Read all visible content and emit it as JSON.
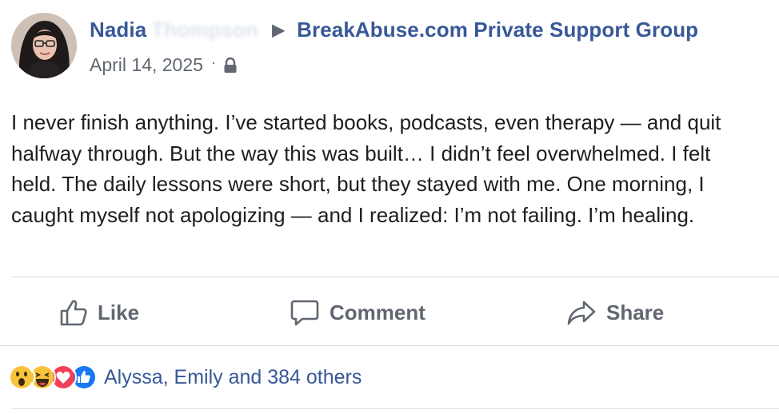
{
  "post": {
    "author_first": "Nadia",
    "author_last": "Thompson",
    "separator_icon": "triangle-right-icon",
    "group_name": "BreakAbuse.com Private Support Group",
    "date": "April 14, 2025",
    "meta_separator": "·",
    "privacy_icon": "lock-icon",
    "text": "I never finish anything. I’ve started books, podcasts, even therapy — and quit halfway through. But the way this was built… I didn’t feel overwhelmed. I felt held. The daily lessons were short, but they stayed with me. One morning, I caught myself not apologizing — and I realized: I’m not failing. I’m healing."
  },
  "actions": {
    "like_label": "Like",
    "comment_label": "Comment",
    "share_label": "Share"
  },
  "reactions": {
    "icons": [
      "wow-icon",
      "haha-icon",
      "love-icon",
      "like-icon"
    ],
    "summary": "Alyssa, Emily and 384 others"
  },
  "colors": {
    "link": "#385898",
    "secondary_text": "#606770",
    "body_text": "#1c1e21",
    "divider": "#dadde1",
    "love": "#f33e58",
    "like": "#1877f2",
    "emoji_yellow": "#f7c33b"
  }
}
